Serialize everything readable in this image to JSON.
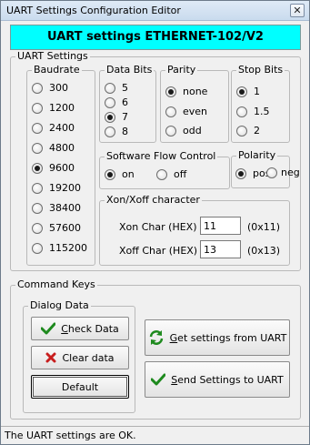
{
  "window": {
    "title": "UART Settings Configuration Editor",
    "close_glyph": "✕"
  },
  "banner": {
    "text": "UART settings ETHERNET-102/V2",
    "color": "#00ffff"
  },
  "uart_settings": {
    "legend": "UART Settings",
    "baudrate": {
      "legend": "Baudrate",
      "options": [
        "300",
        "1200",
        "2400",
        "4800",
        "9600",
        "19200",
        "38400",
        "57600",
        "115200"
      ],
      "selected": "9600"
    },
    "data_bits": {
      "legend": "Data Bits",
      "options": [
        "5",
        "6",
        "7",
        "8"
      ],
      "selected": "7"
    },
    "parity": {
      "legend": "Parity",
      "options": [
        "none",
        "even",
        "odd"
      ],
      "selected": "none"
    },
    "stop_bits": {
      "legend": "Stop Bits",
      "options": [
        "1",
        "1.5",
        "2"
      ],
      "selected": "1"
    },
    "flow_control": {
      "legend": "Software Flow Control",
      "options": [
        "on",
        "off"
      ],
      "selected": "on"
    },
    "polarity": {
      "legend": "Polarity",
      "options": [
        "pos",
        "neg"
      ],
      "selected": "pos"
    },
    "xon_xoff": {
      "legend": "Xon/Xoff character",
      "xon_label": "Xon Char (HEX)",
      "xon_value": "11",
      "xon_hint": "(0x11)",
      "xoff_label": "Xoff Char (HEX)",
      "xoff_value": "13",
      "xoff_hint": "(0x13)"
    }
  },
  "command_keys": {
    "legend": "Command Keys",
    "dialog_data": {
      "legend": "Dialog Data",
      "check_first": "C",
      "check_rest": "heck Data",
      "clear": "Clear data",
      "default": "Default"
    },
    "get_first": "G",
    "get_rest": "et settings from UART",
    "send_first": "S",
    "send_rest": "end Settings to UART"
  },
  "status": {
    "text": "The UART settings are OK."
  },
  "icons": {
    "check": "checkmark-icon",
    "clear": "red-x-icon",
    "refresh": "refresh-arrows-icon",
    "check_color": "#1e8a1e",
    "clear_color": "#c81e1e"
  }
}
